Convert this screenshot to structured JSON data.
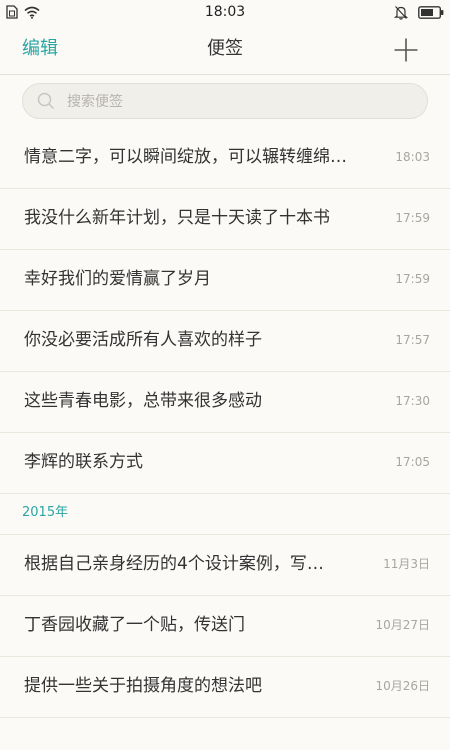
{
  "status_bar": {
    "time": "18:03",
    "icons": {
      "sim": "sim-card-icon",
      "wifi": "wifi-icon",
      "silent": "bell-off-icon",
      "battery": "battery-icon"
    }
  },
  "header": {
    "edit_label": "编辑",
    "title": "便签",
    "add_icon": "plus-icon"
  },
  "search": {
    "placeholder": "搜索便签",
    "icon": "search-icon"
  },
  "notes_recent": [
    {
      "title": "情意二字，可以瞬间绽放，可以辗转缠绵…",
      "time": "18:03"
    },
    {
      "title": "我没什么新年计划，只是十天读了十本书",
      "time": "17:59"
    },
    {
      "title": "幸好我们的爱情赢了岁月",
      "time": "17:59"
    },
    {
      "title": "你没必要活成所有人喜欢的样子",
      "time": "17:57"
    },
    {
      "title": "这些青春电影，总带来很多感动",
      "time": "17:30"
    },
    {
      "title": "李辉的联系方式",
      "time": "17:05"
    }
  ],
  "section_2015": {
    "title": "2015年",
    "notes": [
      {
        "title": "根据自己亲身经历的4个设计案例，写…",
        "time": "11月3日"
      },
      {
        "title": "丁香园收藏了一个贴，传送门",
        "time": "10月27日"
      },
      {
        "title": "提供一些关于拍摄角度的想法吧",
        "time": "10月26日"
      }
    ]
  },
  "colors": {
    "accent": "#2aa6a2",
    "background": "#fbfaf7",
    "text_primary": "#333333",
    "text_secondary": "#a9a6a1",
    "divider": "#ebe7de"
  }
}
